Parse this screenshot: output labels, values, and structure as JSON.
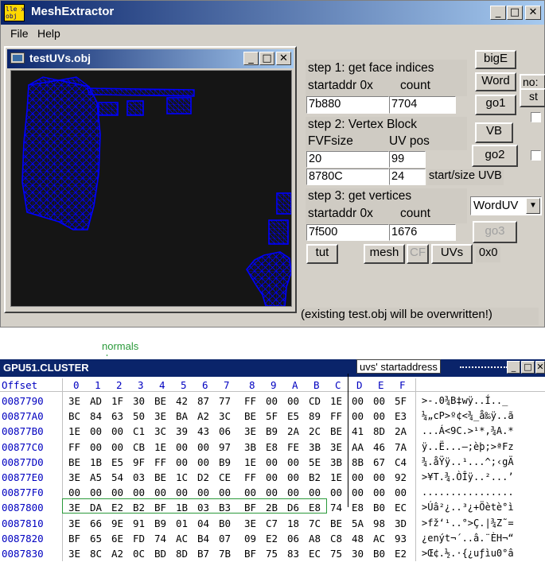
{
  "app": {
    "title": "MeshExtractor",
    "icon_text": "lle x\nobj"
  },
  "menu": {
    "file": "File",
    "help": "Help"
  },
  "viewer": {
    "title": "testUVs.obj"
  },
  "panel": {
    "step1_label": "step 1: get face indices",
    "startaddr_label": "startaddr 0x",
    "count_label": "count",
    "step1_startaddr": "7b880",
    "step1_count": "7704",
    "step2_label": "step 2: Vertex Block",
    "fvfsize_label": "FVFsize",
    "uvpos_label": "UV pos",
    "fvfsize": "20",
    "uvpos": "99",
    "uv_block_start": "8780C",
    "uv_block_size": "24",
    "start_size_uvb_label": "start/size UVB",
    "step3_label": "step 3: get vertices",
    "step3_startaddr_label": "startaddr 0x",
    "step3_count_label": "count",
    "step3_startaddr": "7f500",
    "step3_count": "1676",
    "btn_bigE": "bigE",
    "btn_word": "Word",
    "btn_go1": "go1",
    "btn_vb": "VB",
    "btn_go2": "go2",
    "btn_go3": "go3",
    "btn_tut": "tut",
    "btn_mesh": "mesh",
    "btn_cf": "CF",
    "btn_uvs": "UVs",
    "zero_label": "0x0",
    "uv_format_select": "WordUV",
    "cut_label_no": "no:",
    "cut_label_st": "st",
    "status": "(existing test.obj will be overwritten!)"
  },
  "annotations": {
    "normals": "normals",
    "uvs_start": "uvs' startaddress"
  },
  "hex": {
    "title": "GPU51.CLUSTER",
    "header_offset": "Offset",
    "header_cols": [
      "0",
      "1",
      "2",
      "3",
      "4",
      "5",
      "6",
      "7",
      "8",
      "9",
      "A",
      "B",
      "C",
      "D",
      "E",
      "F"
    ],
    "rows": [
      {
        "offset": "0087790",
        "hex": "3E AD 1F 30 BE 42 87 77 FF 00 00 CD 1E 00 00 5F",
        "ascii": ">-.0¾B‡wÿ..Í.._"
      },
      {
        "offset": "00877A0",
        "hex": "BC 84 63 50 3E BA A2 3C BE 5F E5 89 FF 00 00 E3",
        "ascii": "¼„cP>º¢<¾_å‰ÿ..ã"
      },
      {
        "offset": "00877B0",
        "hex": "1E 00 00 C1 3C 39 43 06 3E B9 2A 2C BE 41 8D 2A",
        "ascii": "...Á<9C.>¹*,¾A.*"
      },
      {
        "offset": "00877C0",
        "hex": "FF 00 00 CB 1E 00 00 97 3B E8 FE 3B 3E AA 46 7A",
        "ascii": "ÿ..Ë...—;èþ;>ªFz"
      },
      {
        "offset": "00877D0",
        "hex": "BE 1B E5 9F FF 00 00 B9 1E 00 00 5E 3B 8B 67 C4",
        "ascii": "¾.åŸÿ..¹...^;‹gÄ"
      },
      {
        "offset": "00877E0",
        "hex": "3E A5 54 03 BE 1C D2 CE FF 00 00 B2 1E 00 00 92",
        "ascii": ">¥T.¾.ÒÎÿ..²...’"
      },
      {
        "offset": "00877F0",
        "hex": "00 00 00 00 00 00 00 00 00 00 00 00 00 00 00 00",
        "ascii": "................"
      },
      {
        "offset": "0087800",
        "hex": "3E DA E2 B2 BF 1B 03 B3 BF 2B D6 E8 74 E8 B0 EC",
        "ascii": ">Úâ²¿..³¿+Öètè°ì"
      },
      {
        "offset": "0087810",
        "hex": "3E 66 9E 91 B9 01 04 B0 3E C7 18 7C BE 5A 98 3D",
        "ascii": ">fž‘¹..°>Ç.|¾Z˜="
      },
      {
        "offset": "0087820",
        "hex": "BF 65 6E FD 74 AC B4 07 09 E2 06 A8 C8 48 AC 93",
        "ascii": "¿enýt¬´..â.¨ÈH¬“"
      },
      {
        "offset": "0087830",
        "hex": "3E 8C A2 0C BD 8D B7 7B BF 75 83 EC 75 30 B0 E2",
        "ascii": ">Œ¢.½.·{¿uƒìu0°â"
      }
    ]
  },
  "colors": {
    "title_start": "#0a246a",
    "title_end": "#a6caf0",
    "mesh": "#0000ff",
    "offset_text": "#0000c0",
    "annotation": "#2a9a3a"
  }
}
